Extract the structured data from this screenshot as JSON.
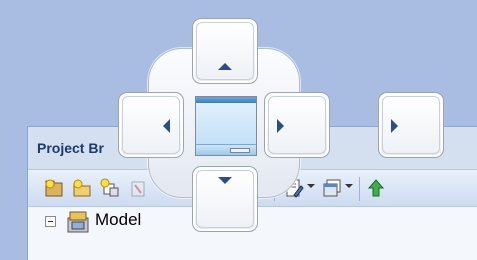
{
  "panel": {
    "title": "Project Br"
  },
  "toolbar": {
    "icons": [
      "new-package-icon",
      "new-folder-icon",
      "new-element-icon",
      "delete-icon",
      "separator",
      "find-icon",
      "separator",
      "edit-icon",
      "dropdown",
      "view-icon",
      "dropdown",
      "separator",
      "move-up-icon"
    ]
  },
  "tree": {
    "items": [
      {
        "label": "Model",
        "icon": "model-icon",
        "expanded": true
      }
    ]
  },
  "dock_guide": {
    "targets": [
      "dock-top",
      "dock-left",
      "dock-center-tabbed",
      "dock-right",
      "dock-bottom",
      "dock-far-right"
    ]
  },
  "colors": {
    "background": "#a9bde3",
    "panel": "#d4dff0",
    "title_text": "#1c3a6b",
    "arrow": "#2a4e87"
  }
}
